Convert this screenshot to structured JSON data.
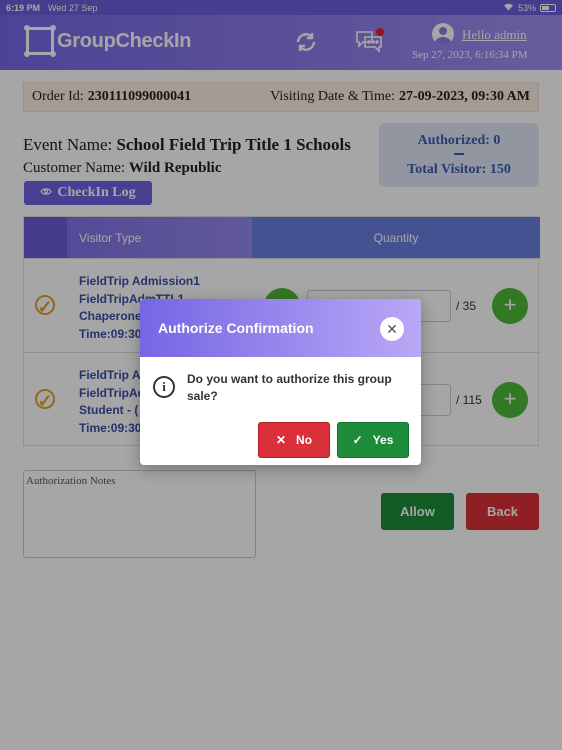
{
  "status_bar": {
    "time": "6:19 PM",
    "date": "Wed 27 Sep",
    "battery": "53%"
  },
  "header": {
    "app_name": "GroupCheckIn",
    "greeting": "Hello admin",
    "datetime": "Sep 27, 2023, 6:16:34 PM",
    "icons": [
      "logo-icon",
      "refresh-icon",
      "chat-icon",
      "user-icon"
    ],
    "notification_color": "#e02030"
  },
  "order": {
    "order_id_label": "Order Id:",
    "order_id": "230111099000041",
    "visit_label": "Visiting Date & Time:",
    "visit_value": "27-09-2023, 09:30 AM"
  },
  "event": {
    "event_label": "Event Name:",
    "event_name": "School Field Trip Title 1 Schools",
    "customer_label": "Customer Name:",
    "customer_name": "Wild Republic",
    "checkin_log_label": "CheckIn Log"
  },
  "authorized": {
    "authorized_text": "Authorized: 0",
    "total_text": "Total Visitor: 150"
  },
  "table": {
    "headers": {
      "visitor_type": "Visitor Type",
      "quantity": "Quantity"
    },
    "rows": [
      {
        "lines": [
          "FieldTrip Admission1",
          "FieldTripAdmTTL1",
          "Chaperone",
          "Time:09:30"
        ],
        "max": "/ 35"
      },
      {
        "lines": [
          "FieldTrip Ac",
          "FieldTripAdr",
          "Student - (",
          "Time:09:30"
        ],
        "max": "/ 115"
      }
    ]
  },
  "notes": {
    "placeholder": "Authorization Notes"
  },
  "buttons": {
    "allow": "Allow",
    "back": "Back"
  },
  "modal": {
    "title": "Authorize Confirmation",
    "message": "Do you want to authorize this group sale?",
    "no_label": "No",
    "yes_label": "Yes"
  }
}
